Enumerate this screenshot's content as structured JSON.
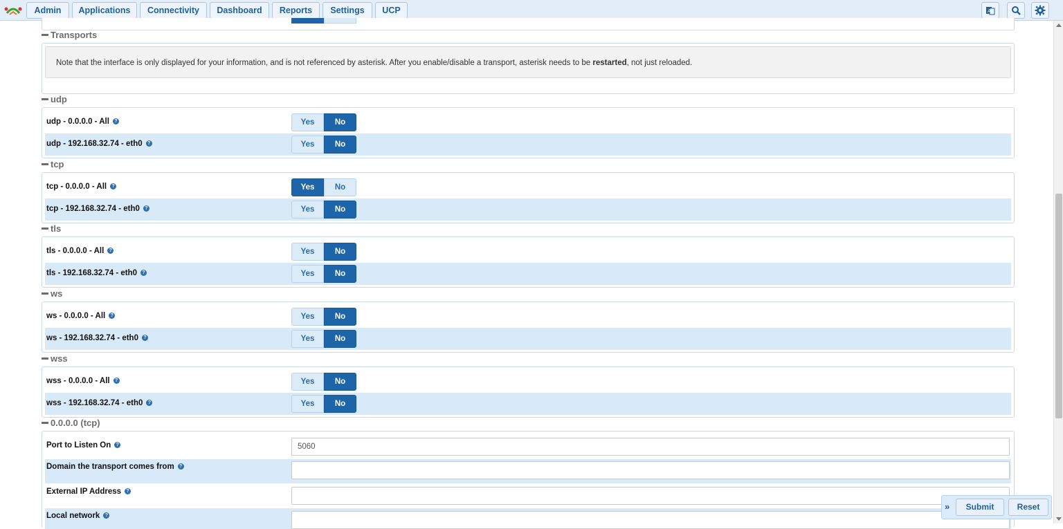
{
  "nav": {
    "items": [
      {
        "label": "Admin"
      },
      {
        "label": "Applications"
      },
      {
        "label": "Connectivity"
      },
      {
        "label": "Dashboard"
      },
      {
        "label": "Reports"
      },
      {
        "label": "Settings"
      },
      {
        "label": "UCP"
      }
    ],
    "icons": [
      "language-icon",
      "search-icon",
      "gear-icon"
    ]
  },
  "transports": {
    "title": "Transports",
    "note_pre": "Note that the interface is only displayed for your information, and is not referenced by asterisk. After you enable/disable a transport, asterisk needs to be ",
    "note_bold": "restarted",
    "note_post": ", not just reloaded."
  },
  "toggle_labels": {
    "yes": "Yes",
    "no": "No"
  },
  "groups": [
    {
      "title": "udp",
      "rows": [
        {
          "label": "udp - 0.0.0.0 - All",
          "value": "No"
        },
        {
          "label": "udp - 192.168.32.74 - eth0",
          "value": "No"
        }
      ]
    },
    {
      "title": "tcp",
      "rows": [
        {
          "label": "tcp - 0.0.0.0 - All",
          "value": "Yes"
        },
        {
          "label": "tcp - 192.168.32.74 - eth0",
          "value": "No"
        }
      ]
    },
    {
      "title": "tls",
      "rows": [
        {
          "label": "tls - 0.0.0.0 - All",
          "value": "No"
        },
        {
          "label": "tls - 192.168.32.74 - eth0",
          "value": "No"
        }
      ]
    },
    {
      "title": "ws",
      "rows": [
        {
          "label": "ws - 0.0.0.0 - All",
          "value": "No"
        },
        {
          "label": "ws - 192.168.32.74 - eth0",
          "value": "No"
        }
      ]
    },
    {
      "title": "wss",
      "rows": [
        {
          "label": "wss - 0.0.0.0 - All",
          "value": "No"
        },
        {
          "label": "wss - 192.168.32.74 - eth0",
          "value": "No"
        }
      ]
    }
  ],
  "tcp_settings": {
    "title": "0.0.0.0 (tcp)",
    "fields": [
      {
        "label": "Port to Listen On",
        "value": "5060"
      },
      {
        "label": "Domain the transport comes from",
        "value": ""
      },
      {
        "label": "External IP Address",
        "value": ""
      },
      {
        "label": "Local network",
        "value": ""
      }
    ]
  },
  "actions": {
    "expand": "»",
    "submit": "Submit",
    "reset": "Reset"
  },
  "colors": {
    "accent": "#1d65a8",
    "row_alt": "#d8e9f7",
    "nav_bg": "#e4eef8"
  }
}
